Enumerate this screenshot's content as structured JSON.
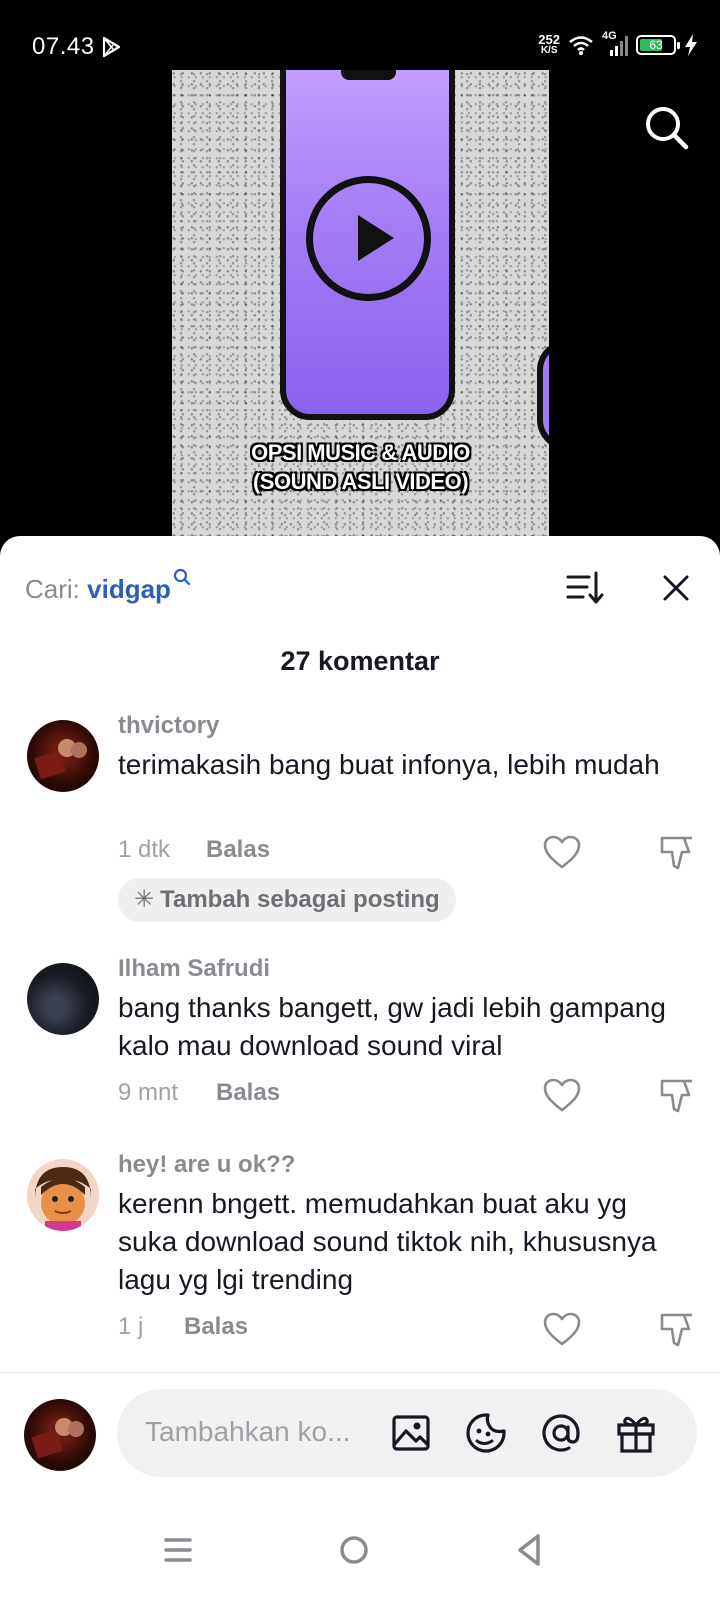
{
  "status_bar": {
    "time": "07.43",
    "net_speed_value": "252",
    "net_speed_unit": "K/S",
    "network": "4G",
    "battery": "63"
  },
  "video": {
    "caption_line1": "OPSI MUSIC & AUDIO",
    "caption_line2": "(SOUND ASLI VIDEO)"
  },
  "comments_sheet": {
    "search_prefix": "Cari:",
    "search_term": "vidgap",
    "count_label": "27 komentar",
    "comments": [
      {
        "username": "thvictory",
        "text": "terimakasih bang buat infonya, lebih mudah",
        "time": "1 dtk",
        "reply_label": "Balas",
        "chip_label": "Tambah sebagai posting"
      },
      {
        "username": "Ilham Safrudi",
        "text": "bang thanks bangett, gw jadi lebih gampang kalo mau download sound viral",
        "time": "9 mnt",
        "reply_label": "Balas"
      },
      {
        "username": "hey! are u ok??",
        "text": "kerenn bngett. memudahkan buat aku yg suka download sound tiktok nih, khususnya lagu yg lgi trending",
        "time": "1 j",
        "reply_label": "Balas"
      }
    ],
    "input_placeholder": "Tambahkan ko..."
  },
  "colors": {
    "search_term": "#2b5fb8",
    "battery_fill": "#2dbe5c",
    "phone_purple": "#a37cf5"
  }
}
